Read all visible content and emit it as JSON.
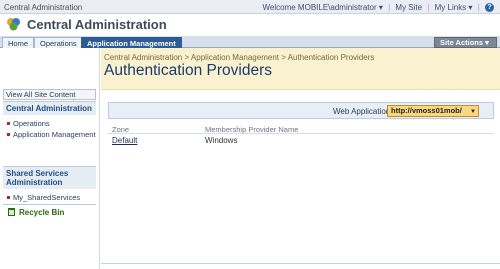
{
  "topbar": {
    "site_name": "Central Administration",
    "welcome": "Welcome MOBILE\\administrator",
    "my_site": "My Site",
    "my_links": "My Links",
    "help_icon": "?"
  },
  "header": {
    "title": "Central Administration",
    "logo_icon": "sharepoint-logo-icon"
  },
  "tabs": [
    {
      "label": "Home"
    },
    {
      "label": "Operations"
    },
    {
      "label": "Application Management"
    }
  ],
  "site_actions": "Site Actions",
  "leftnav": {
    "view_all": "View All Site Content",
    "groups": [
      {
        "header": "Central Administration",
        "items": [
          "Operations",
          "Application Management"
        ]
      },
      {
        "header": "Shared Services Administration",
        "items": [
          "My_SharedServices"
        ]
      }
    ],
    "recycle_bin": "Recycle Bin"
  },
  "content": {
    "breadcrumb": "Central Administration > Application Management > Authentication Providers",
    "title": "Authentication Providers",
    "web_app_label": "Web Application:",
    "web_app_value": "http://vmoss01mob/",
    "columns": [
      "Zone",
      "Membership Provider Name"
    ],
    "rows": [
      {
        "zone": "Default",
        "provider": "Windows"
      }
    ]
  },
  "colors": {
    "accent": "#2d5c95",
    "title_band": "#f9f1cf",
    "select_bg": "#fad680"
  }
}
